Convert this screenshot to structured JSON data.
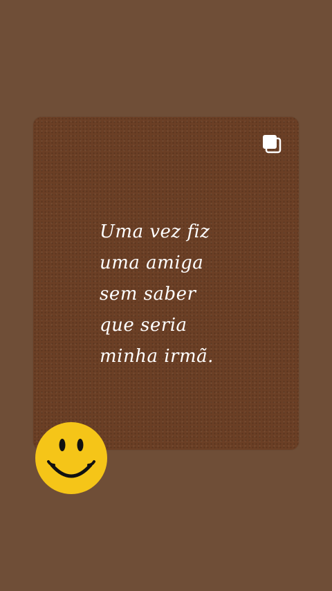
{
  "quote": {
    "lines": [
      "Uma vez fiz",
      "uma amiga",
      "sem saber",
      "que seria",
      "minha irmã."
    ]
  },
  "icons": {
    "corner": "multiple-images-icon",
    "sticker": "smiley-face-icon"
  },
  "colors": {
    "page_background": "#6f4e37",
    "card_background": "#6b3f25",
    "text": "#ffffff",
    "smiley_yellow": "#f5c518"
  }
}
